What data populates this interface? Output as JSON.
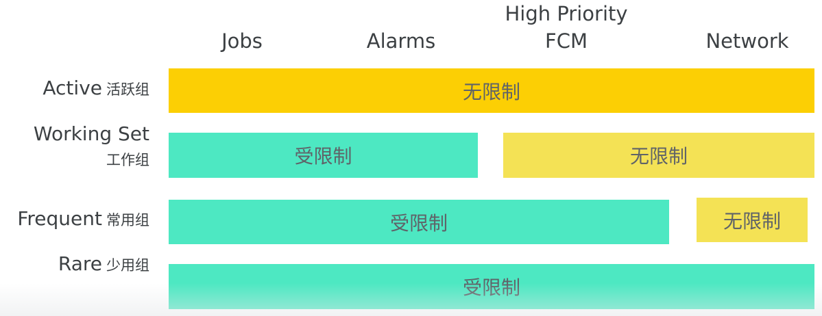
{
  "columns": {
    "jobs": "Jobs",
    "alarms": "Alarms",
    "fcm_line1": "High Priority",
    "fcm_line2": "FCM",
    "network": "Network"
  },
  "rows": {
    "active": {
      "en": "Active",
      "zh": "活跃组"
    },
    "working_set": {
      "en": "Working Set",
      "zh": "工作组"
    },
    "frequent": {
      "en": "Frequent",
      "zh": "常用组"
    },
    "rare": {
      "en": "Rare",
      "zh": "少用组"
    }
  },
  "bars": {
    "active_all": "无限制",
    "working_set_restricted": "受限制",
    "working_set_unrestricted": "无限制",
    "frequent_restricted": "受限制",
    "frequent_unrestricted": "无限制",
    "rare_all": "受限制"
  },
  "colors": {
    "unrestricted_strong": "#fccf04",
    "unrestricted_soft": "#f4e255",
    "restricted": "#4de8c2",
    "text": "#3c4043"
  }
}
